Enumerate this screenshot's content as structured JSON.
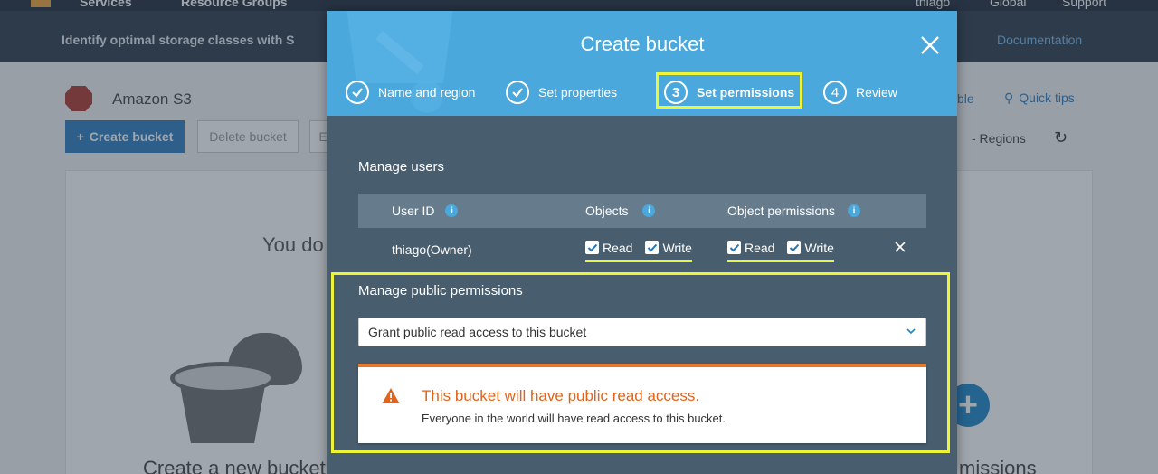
{
  "background": {
    "topnav": {
      "services": "Services",
      "resource_groups": "Resource Groups",
      "user": "thiago",
      "region": "Global",
      "support": "Support"
    },
    "subbar": {
      "message": "Identify optimal storage classes with S",
      "documentation": "Documentation"
    },
    "s3_title": "Amazon S3",
    "create_bucket_button": "Create bucket",
    "delete_bucket_button": "Delete bucket",
    "truncated_button": "E",
    "right_link_fragment": "ble",
    "quick_tips": "Quick tips",
    "regions": "- Regions",
    "empty_text": "You do",
    "create_new_bucket": "Create a new bucket",
    "permissions_fragment": "missions"
  },
  "modal": {
    "title": "Create bucket",
    "steps": [
      {
        "number": "1",
        "label": "Name and region",
        "status": "done"
      },
      {
        "number": "2",
        "label": "Set properties",
        "status": "done"
      },
      {
        "number": "3",
        "label": "Set permissions",
        "status": "active"
      },
      {
        "number": "4",
        "label": "Review",
        "status": "pending"
      }
    ],
    "manage_users": {
      "label": "Manage users",
      "columns": [
        "User ID",
        "Objects",
        "Object permissions"
      ],
      "row": {
        "user_id": "thiago(Owner)",
        "objects": [
          {
            "label": "Read",
            "checked": true
          },
          {
            "label": "Write",
            "checked": true
          }
        ],
        "object_permissions": [
          {
            "label": "Read",
            "checked": true
          },
          {
            "label": "Write",
            "checked": true
          }
        ]
      }
    },
    "manage_public": {
      "label": "Manage public permissions",
      "selected_option": "Grant public read access to this bucket"
    },
    "warning": {
      "title": "This bucket will have public read access.",
      "text": "Everyone in the world will have read access to this bucket."
    }
  },
  "colors": {
    "header_blue": "#4aa8dd",
    "modal_body": "#485e6f",
    "highlight_yellow": "#eef536",
    "warning_orange": "#e0641d"
  }
}
